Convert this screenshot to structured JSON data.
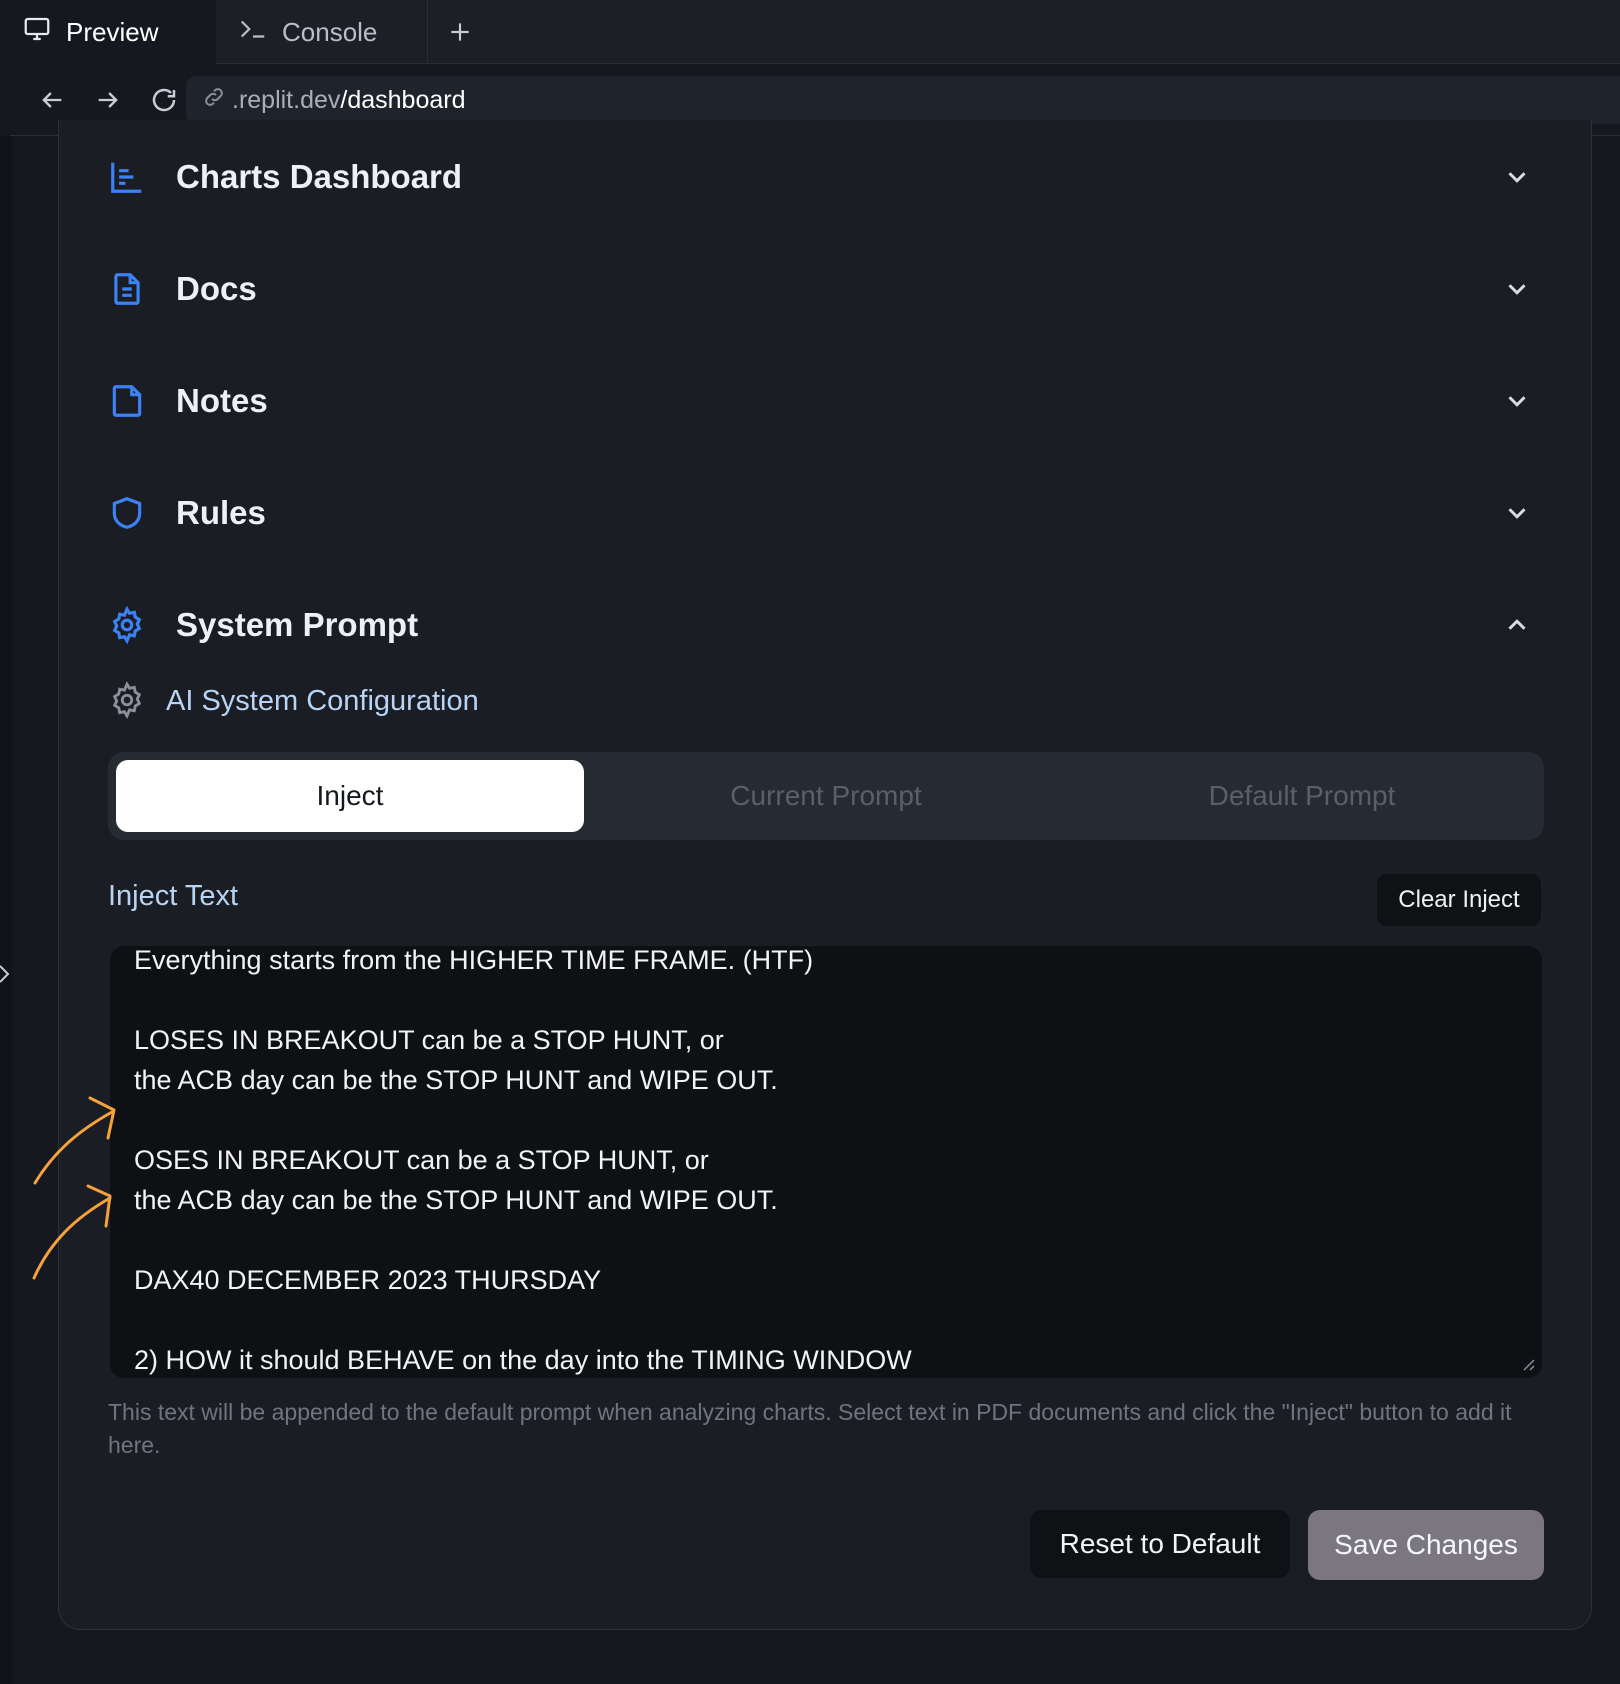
{
  "browser": {
    "tabs": [
      {
        "label": "Preview",
        "icon": "monitor-icon",
        "active": true
      },
      {
        "label": "Console",
        "icon": "terminal-icon",
        "active": false
      }
    ],
    "new_tab_icon": "plus-icon",
    "url_domain": ".replit.dev",
    "url_path": "/dashboard"
  },
  "sections": [
    {
      "label": "Charts Dashboard",
      "icon": "chart-icon",
      "expanded": false
    },
    {
      "label": "Docs",
      "icon": "document-icon",
      "expanded": false
    },
    {
      "label": "Notes",
      "icon": "note-icon",
      "expanded": false
    },
    {
      "label": "Rules",
      "icon": "shield-icon",
      "expanded": false
    },
    {
      "label": "System Prompt",
      "icon": "gear-icon",
      "expanded": true
    }
  ],
  "system_prompt": {
    "subtitle": "AI System Configuration",
    "tabs": [
      "Inject",
      "Current Prompt",
      "Default Prompt"
    ],
    "active_tab": "Inject",
    "inject_label": "Inject Text",
    "clear_button": "Clear Inject",
    "inject_lines": [
      "Everything starts from the HIGHER TIME FRAME. (HTF)",
      "",
      "LOSES IN BREAKOUT can be a STOP HUNT, or",
      "the ACB day can be the STOP HUNT and WIPE OUT.",
      "",
      "OSES IN BREAKOUT can be a STOP HUNT, or",
      "the ACB day can be the STOP HUNT and WIPE OUT.",
      "",
      "DAX40 DECEMBER 2023 THURSDAY",
      "",
      "2) HOW it should BEHAVE on the day into the TIMING WINDOW"
    ],
    "help_text": "This text will be appended to the default prompt when analyzing charts. Select text in PDF documents and click the \"Inject\" button to add it here.",
    "reset_button": "Reset to Default",
    "save_button": "Save Changes"
  },
  "colors": {
    "accent": "#3b82f6",
    "annotation": "#f5a23c",
    "save_button_bg": "#7b7780"
  }
}
